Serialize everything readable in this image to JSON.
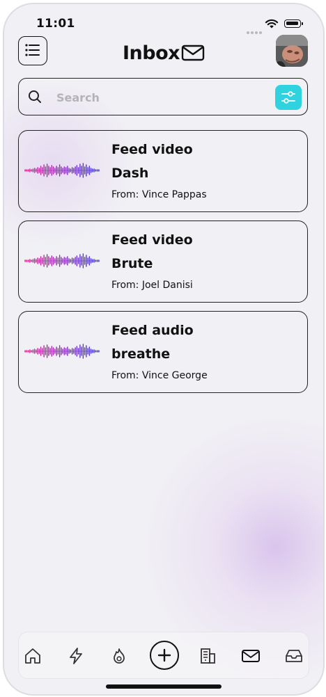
{
  "status_bar": {
    "time": "11:01"
  },
  "header": {
    "title": "Inbox"
  },
  "search": {
    "placeholder": "Search"
  },
  "messages": [
    {
      "type": "Feed video",
      "name": "Dash",
      "from": "From: Vince Pappas"
    },
    {
      "type": "Feed video",
      "name": "Brute",
      "from": "From: Joel Danisi"
    },
    {
      "type": "Feed audio",
      "name": "breathe",
      "from": "From: Vince George"
    }
  ],
  "icons": {
    "menu": "list-menu-icon",
    "title": "envelope-icon",
    "search": "search-icon",
    "filter": "sliders-icon",
    "nav": [
      "home-icon",
      "lightning-icon",
      "flame-icon",
      "add-circle-icon",
      "building-icon",
      "mail-icon",
      "inbox-tray-icon"
    ]
  },
  "colors": {
    "accent": "#2fd3e0",
    "wave_start": "#e0208f",
    "wave_end": "#3c3ae0",
    "background": "#f1f0f4"
  }
}
